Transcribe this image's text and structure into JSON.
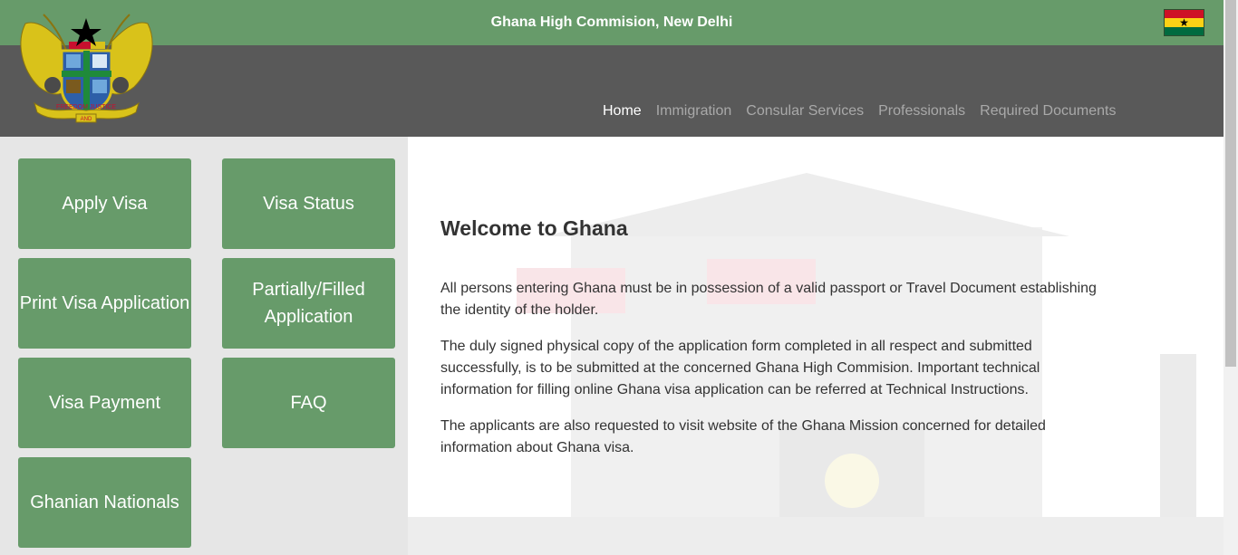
{
  "header": {
    "title": "Ghana High Commision, New Delhi",
    "flag_icon": "ghana-flag-icon",
    "logo_icon": "ghana-coat-of-arms-icon",
    "logo_motto": "FREEDOM AND JUSTICE"
  },
  "nav": {
    "items": [
      {
        "label": "Home",
        "active": true
      },
      {
        "label": "Immigration",
        "active": false
      },
      {
        "label": "Consular Services",
        "active": false
      },
      {
        "label": "Professionals",
        "active": false
      },
      {
        "label": "Required Documents",
        "active": false
      }
    ]
  },
  "tiles": [
    {
      "label": "Apply Visa"
    },
    {
      "label": "Visa Status"
    },
    {
      "label": "Print Visa Application"
    },
    {
      "label": "Partially/Filled Application"
    },
    {
      "label": "Visa Payment"
    },
    {
      "label": "FAQ"
    },
    {
      "label": "Ghanian Nationals"
    }
  ],
  "main": {
    "heading": "Welcome to Ghana",
    "paragraphs": [
      "All persons entering Ghana must be in possession of a valid passport or Travel Document establishing the identity of the holder.",
      "The duly signed physical copy of the application form completed in all respect and submitted successfully, is to be submitted at the concerned Ghana High Commision. Important technical information for filling online Ghana visa application can be referred at Technical Instructions.",
      "The applicants are also requested to visit website of the Ghana Mission concerned for detailed information about Ghana visa."
    ]
  },
  "colors": {
    "accent_green": "#679b6a",
    "nav_band": "#595959",
    "sidebar_bg": "#e6e6e6"
  }
}
